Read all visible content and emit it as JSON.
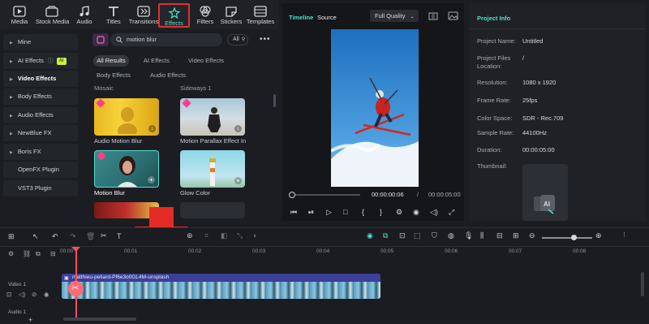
{
  "toolbar": {
    "items": [
      {
        "label": "Media",
        "icon": "media-icon"
      },
      {
        "label": "Stock Media",
        "icon": "stock-media-icon"
      },
      {
        "label": "Audio",
        "icon": "audio-icon"
      },
      {
        "label": "Titles",
        "icon": "titles-icon"
      },
      {
        "label": "Transitions",
        "icon": "transitions-icon"
      },
      {
        "label": "Effects",
        "icon": "effects-icon"
      },
      {
        "label": "Filters",
        "icon": "filters-icon"
      },
      {
        "label": "Stickers",
        "icon": "stickers-icon"
      },
      {
        "label": "Templates",
        "icon": "templates-icon"
      }
    ],
    "active": "Effects"
  },
  "leftnav": {
    "items": [
      "Mine",
      "AI Effects",
      "Video Effects",
      "Body Effects",
      "Audio Effects",
      "NewBlue FX",
      "Boris FX",
      "OpenFX Plugin",
      "VST3 Plugin"
    ],
    "ai_badge": "AI"
  },
  "effects": {
    "search_value": "motion blur",
    "filter_label": "All",
    "tabs_row1": [
      "All Results",
      "AI Effects",
      "Video Effects"
    ],
    "tabs_row2": [
      "Body Effects",
      "Audio Effects"
    ],
    "group_left": "Mosaic",
    "group_right": "Sideways 1",
    "cards": [
      {
        "label": "Audio Motion Blur"
      },
      {
        "label": "Motion Parallax Effect In"
      },
      {
        "label": "Motion Blur"
      },
      {
        "label": "Glow Color"
      }
    ]
  },
  "preview": {
    "tab_timeline": "Timeline",
    "tab_source": "Source",
    "quality": "Full Quality",
    "current_time": "00:00:00:06",
    "separator": "/",
    "total_time": "00:00:05:00",
    "progress": 0.02
  },
  "project": {
    "title": "Project Info",
    "rows": [
      {
        "label": "Project Name:",
        "value": "Untitled"
      },
      {
        "label": "Project Files Location:",
        "value": "/"
      },
      {
        "label": "Resolution:",
        "value": "1080 x 1920"
      },
      {
        "label": "Frame Rate:",
        "value": "25fps"
      },
      {
        "label": "Color Space:",
        "value": "SDR - Rec.709"
      },
      {
        "label": "Sample Rate:",
        "value": "44100Hz"
      },
      {
        "label": "Duration:",
        "value": "00:00:05:00"
      },
      {
        "label": "Thumbnail:",
        "value": ""
      }
    ]
  },
  "timeline": {
    "ruler": [
      "00:00",
      "00:01",
      "00:02",
      "00:03",
      "00:04",
      "00:05",
      "00:06",
      "00:07",
      "00:08"
    ],
    "video_track_label": "Video 1",
    "audio_track_label": "Audio 1",
    "clip_name": "matthieu-petiard-Pf6e3o0GL4M-unsplash",
    "add_label": "+"
  },
  "colors": {
    "accent": "#4fe0c8",
    "highlight": "#e0302f",
    "clip": "#3b3f99",
    "playhead": "#ff4d5a"
  }
}
